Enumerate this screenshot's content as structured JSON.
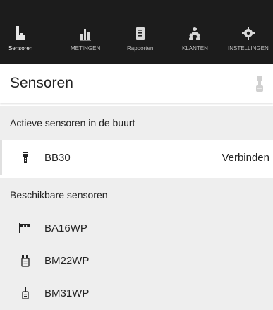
{
  "tabs": [
    {
      "label": "Sensoren",
      "icon": "sensor-icon",
      "active": true
    },
    {
      "label": "METINGEN",
      "icon": "chart-icon",
      "active": false
    },
    {
      "label": "Rapporten",
      "icon": "report-icon",
      "active": false
    },
    {
      "label": "KLANTEN",
      "icon": "customers-icon",
      "active": false
    },
    {
      "label": "INSTELLINGEN",
      "icon": "gear-icon",
      "active": false
    }
  ],
  "header": {
    "title": "Sensoren",
    "right_icon": "sensor-device-icon"
  },
  "sections": {
    "nearby": {
      "title": "Actieve sensoren in de buurt",
      "items": [
        {
          "name": "BB30",
          "action": "Verbinden",
          "icon": "probe-icon"
        }
      ]
    },
    "available": {
      "title": "Beschikbare sensoren",
      "items": [
        {
          "name": "BA16WP",
          "icon": "pin-probe-icon"
        },
        {
          "name": "BM22WP",
          "icon": "twin-probe-icon"
        },
        {
          "name": "BM31WP",
          "icon": "single-probe-icon"
        }
      ]
    }
  },
  "colors": {
    "tabbar": "#1c1c1c",
    "section_bg": "#eeeeee",
    "text": "#222222",
    "tab_label_inactive": "#bdbdbd",
    "tab_label_active": "#ffffff"
  }
}
